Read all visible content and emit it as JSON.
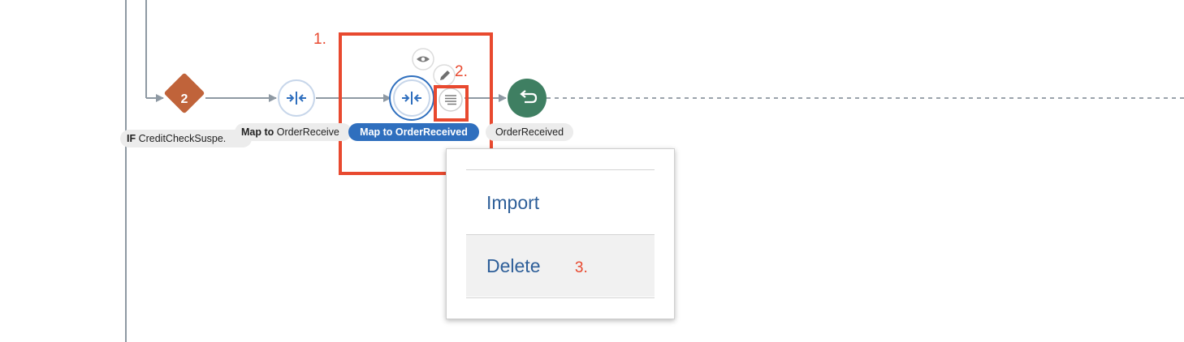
{
  "flow": {
    "if_node": {
      "badge": "2",
      "keyword": "IF",
      "label": "CreditCheckSuspe."
    },
    "map_node_1": {
      "keyword": "Map to",
      "label": "OrderReceive"
    },
    "map_node_2": {
      "label": "Map to OrderReceived"
    },
    "end_node": {
      "label": "OrderReceived"
    }
  },
  "annotations": {
    "step1": "1.",
    "step2": "2.",
    "step3": "3."
  },
  "menu": {
    "items": [
      {
        "label": "Import"
      },
      {
        "label": "Delete"
      }
    ]
  },
  "colors": {
    "annotation_red": "#e8492f",
    "if_node": "#c0633a",
    "map_icon": "#2f6fbe",
    "end_node": "#3f7f62",
    "selected_pill": "#2f6fbe",
    "menu_text": "#2e5f99"
  },
  "icons": {
    "if_node": "diamond",
    "map_node": "merge-arrows-icon",
    "view": "eye-icon",
    "edit": "pencil-icon",
    "actions": "hamburger-menu-icon",
    "end": "return-arrow-icon"
  }
}
